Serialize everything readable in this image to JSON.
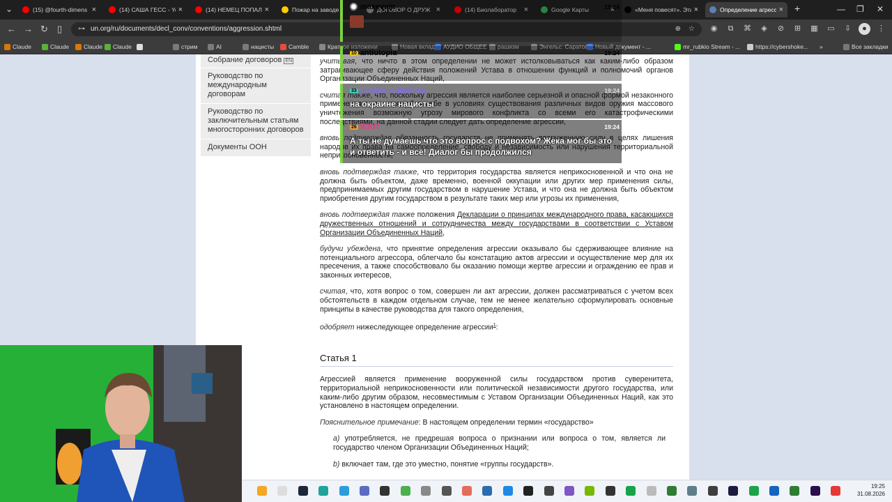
{
  "browser": {
    "tabs": [
      {
        "title": "(15) @fourth-dimens",
        "icon": "youtube-icon",
        "color": "#ff0000",
        "active": false
      },
      {
        "title": "(14) САША ГЕСС - Yo",
        "icon": "youtube-icon",
        "color": "#ff0000",
        "active": false
      },
      {
        "title": "(14) НЕМЕЦ ПОПАЛ",
        "icon": "youtube-icon",
        "color": "#ff0000",
        "active": false
      },
      {
        "title": "Пожар на заводе г",
        "icon": "news-icon",
        "color": "#ffcc00",
        "active": false
      },
      {
        "title": "ДОГОВОР О ДРУЖ",
        "icon": "doc-icon",
        "color": "#888888",
        "active": false
      },
      {
        "title": "(14) Биолаборатор",
        "icon": "youtube-icon",
        "color": "#ff0000",
        "active": false
      },
      {
        "title": "Google Карты",
        "icon": "maps-icon",
        "color": "#34a853",
        "active": false
      },
      {
        "title": "«Меня повесят». Эта",
        "icon": "meduza-icon",
        "color": "#000000",
        "active": false
      },
      {
        "title": "Определение агресси",
        "icon": "globe-icon",
        "color": "#5b7fb6",
        "active": true
      }
    ],
    "url": "un.org/ru/documents/decl_conv/conventions/aggression.shtml",
    "bookmarks": [
      {
        "label": "Claude",
        "color": "#d97706"
      },
      {
        "label": "Claude",
        "color": "#5ab03c"
      },
      {
        "label": "Claude",
        "color": "#d97706"
      },
      {
        "label": "Claude",
        "color": "#5ab03c"
      },
      {
        "label": "",
        "color": "#dddddd"
      },
      {
        "label": "стрим",
        "color": "#7a7a7a"
      },
      {
        "label": "AI",
        "color": "#7a7a7a"
      },
      {
        "label": "нацисты",
        "color": "#7a7a7a"
      },
      {
        "label": "Camble",
        "color": "#e74c3c"
      },
      {
        "label": "Краткое изложени",
        "color": "#888888"
      },
      {
        "label": "Новая вкладка",
        "color": "#888888"
      },
      {
        "label": "АУДИО ОБЩЕЕ",
        "color": "#3b82f6"
      },
      {
        "label": "рашизм",
        "color": "#888888"
      },
      {
        "label": "Энгельс: Саратовск",
        "color": "#888888"
      },
      {
        "label": "Новый документ - ...",
        "color": "#4285f4"
      },
      {
        "label": "mr_rubkio Stream - ...",
        "color": "#53fc18"
      },
      {
        "label": "https://cybershoke...",
        "color": "#cccccc"
      }
    ],
    "all_bookmarks": "Все закладки"
  },
  "sidebar": {
    "items": [
      "Собрание договоров",
      "Руководство по международным договорам",
      "Руководство по заключительным статьям многосторонних договоров",
      "Документы ООН"
    ]
  },
  "doc": {
    "p1_em": "учитывая",
    "p1": ", что ничто в этом определении не может истолковываться как каким-либо образом затрагивающее сферу действия положений Устава в отношении функций и полномочий органов Организации Объединенных Наций,",
    "p2_em": "считая также",
    "p2": ", что, поскольку агрессия является наиболее серьезной и опасной формой незаконного применения силы, таящей в себе в условиях существования различных видов оружия массового уничтожения возможную угрозу мирового конфликта со всеми его катастрофическими последствиями, на данной стадии следует дать определение агрессии,",
    "p3_em": "вновь подтверждая",
    "p3": " обязанность государств не применять вооруженную силу в целях лишения народов их права на самоопределение, свободу и независимость или нарушения территориальной неприкосновенности,",
    "p4_em": "вновь подтверждая также",
    "p4": ", что территория государства является неприкосновенной и что она не должна быть объектом, даже временно, военной оккупации или других мер применения силы, предпринимаемых другим государством в нарушение Устава, и что она не должна быть объектом приобретения другим государством в результате таких мер или угрозы их применения,",
    "p5_em": "вновь подтверждая также",
    "p5_a": " положения ",
    "p5_link": "Декларации о принципах международного права, касающихся дружественных отношений и сотрудничества между государствами в соответствии с Уставом Организации Объединенных Наций",
    "p5_b": ",",
    "p6_em": "будучи убеждена",
    "p6": ", что принятие определения агрессии оказывало бы сдерживающее влияние на потенциального агрессора, облегчало бы констатацию актов агрессии и осуществление мер для их пресечения, а также способствовало бы оказанию помощи жертве агрессии и ограждению ее прав и законных интересов,",
    "p7_em": "считая",
    "p7": ", что, хотя вопрос о том, совершен ли акт агрессии, должен рассматриваться с учетом всех обстоятельств в каждом отдельном случае, тем не менее желательно сформулировать основные принципы в качестве руководства для такого определения,",
    "p8_em": "одобряет",
    "p8": " нижеследующее определение агрессии",
    "p8_sup": "1",
    "p8_end": ":",
    "article_title": "Статья 1",
    "a1": "Агрессией является применение вооруженной силы государством против суверенитета, территориальной неприкосновенности или политической независимости другого государства, или каким-либо другим образом, несовместимым с Уставом Организации Объединенных Наций, как это установлено в настоящем определении.",
    "note_em": "Пояснительное примечание",
    "note": ": В настоящем определении термин «государство»",
    "a_em": "а)",
    "a_text": " употребляется, не предрешая вопроса о признании или вопроса о том, является ли государство членом Организации Объединенных Наций;",
    "b_em": "b)",
    "b_text": " включает там, где это уместно, понятие «группы государств»."
  },
  "chat": [
    {
      "badge": "",
      "user": "maxevain",
      "time": "19:24",
      "msg": "",
      "user_color": "#000000"
    },
    {
      "badge": "10",
      "user": "antiutopia",
      "time": "19:24",
      "msg": "на окраине нацисты",
      "user_color": "#000000"
    },
    {
      "badge": "33",
      "user": "jalkaya_oukashka",
      "time": "19:24",
      "msg": "",
      "user_color": "#7c6cf5"
    },
    {
      "badge": "26",
      "user": "R3UT",
      "time": "19:24",
      "msg": "А ты не думаешь что это вопрос с подвохом? Жека мог бы это и ответить - и всё! Диалог бы продолжился",
      "user_color": "#e23b83"
    }
  ],
  "taskbar": {
    "time": "19:25",
    "date": "31.08.2026"
  }
}
